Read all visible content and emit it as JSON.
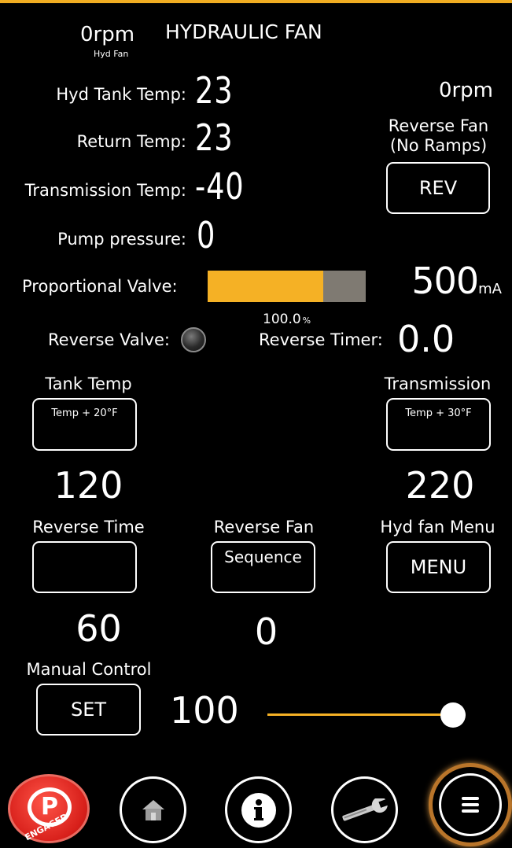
{
  "header": {
    "rpm_small_value": "0rpm",
    "rpm_small_caption": "Hyd Fan",
    "title": "HYDRAULIC FAN",
    "rpm_right": "0rpm"
  },
  "readings": {
    "hyd_tank_temp_label": "Hyd Tank Temp:",
    "hyd_tank_temp_value": "23",
    "return_temp_label": "Return Temp:",
    "return_temp_value": "23",
    "transmission_temp_label": "Transmission Temp:",
    "transmission_temp_value": "-40",
    "pump_pressure_label": "Pump pressure:",
    "pump_pressure_value": "0"
  },
  "reverse_fan": {
    "label_line1": "Reverse Fan",
    "label_line2": "(No Ramps)",
    "button": "REV"
  },
  "proportional_valve": {
    "label": "Proportional Valve:",
    "fill_fraction": 0.73,
    "percent": "100.0",
    "percent_unit": "%",
    "current_value": "500",
    "current_unit": "mA",
    "bar_color": "#f5b125"
  },
  "reverse_valve": {
    "label": "Reverse Valve:"
  },
  "reverse_timer": {
    "label": "Reverse Timer:",
    "value": "0.0"
  },
  "tank_temp": {
    "label": "Tank Temp",
    "button_text": "Temp + 20°F",
    "value": "120"
  },
  "transmission": {
    "label": "Transmission",
    "button_text": "Temp + 30°F",
    "value": "220"
  },
  "reverse_time": {
    "label": "Reverse Time",
    "button_text": "",
    "value": "60"
  },
  "reverse_fan_sequence": {
    "label": "Reverse Fan",
    "button_text": "Sequence",
    "value": "0"
  },
  "hyd_fan_menu": {
    "label": "Hyd fan Menu",
    "button": "MENU"
  },
  "manual_control": {
    "label": "Manual Control",
    "button": "SET",
    "value": "100",
    "slider_fraction": 1.0,
    "slider_color": "#f5b125"
  },
  "bottom_nav": {
    "parking_letter": "P",
    "parking_caption": "ENGAGED",
    "icons": [
      "parking-brake-icon",
      "home-icon",
      "info-icon",
      "wrench-icon",
      "hamburger-menu-icon"
    ]
  }
}
